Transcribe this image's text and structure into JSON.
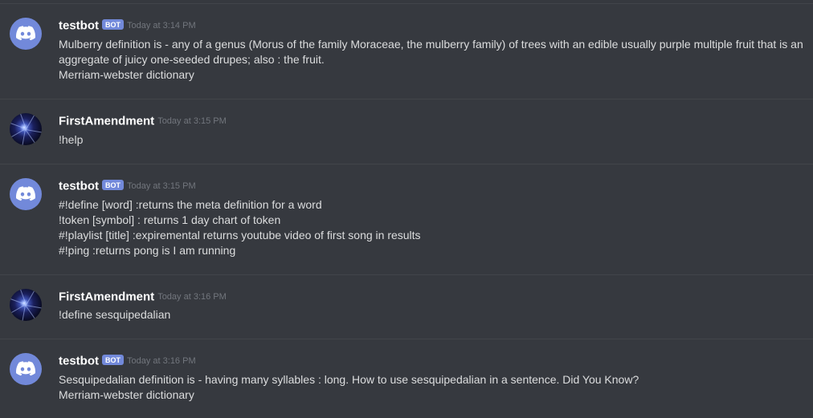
{
  "messages": [
    {
      "author": "testbot",
      "bot_tag": "BOT",
      "timestamp": "Today at 3:14 PM",
      "lines": [
        "Mulberry definition is - any of a genus (Morus of the family Moraceae, the mulberry family) of trees with an edible usually purple multiple fruit that is an",
        "aggregate of juicy one-seeded drupes; also : the fruit.",
        "Merriam-webster dictionary"
      ]
    },
    {
      "author": "FirstAmendment",
      "timestamp": "Today at 3:15 PM",
      "lines": [
        "!help"
      ]
    },
    {
      "author": "testbot",
      "bot_tag": "BOT",
      "timestamp": "Today at 3:15 PM",
      "lines": [
        "#!define [word] :returns the meta definition for a word",
        "!token [symbol] : returns 1 day chart of token",
        "#!playlist [title] :expiremental returns youtube video of first song in results",
        "#!ping :returns pong is I am running"
      ]
    },
    {
      "author": "FirstAmendment",
      "timestamp": "Today at 3:16 PM",
      "lines": [
        "!define sesquipedalian"
      ]
    },
    {
      "author": "testbot",
      "bot_tag": "BOT",
      "timestamp": "Today at 3:16 PM",
      "lines": [
        "Sesquipedalian definition is - having many syllables : long. How to use sesquipedalian in a sentence. Did You Know?",
        "Merriam-webster dictionary"
      ]
    }
  ],
  "icons": {
    "bot_avatar": "discord-logo-icon",
    "user_avatar": "galaxy-avatar"
  },
  "colors": {
    "background": "#36393f",
    "bot_tag": "#7289da",
    "username": "#ffffff",
    "timestamp": "#72767d",
    "text": "#dcddde"
  }
}
